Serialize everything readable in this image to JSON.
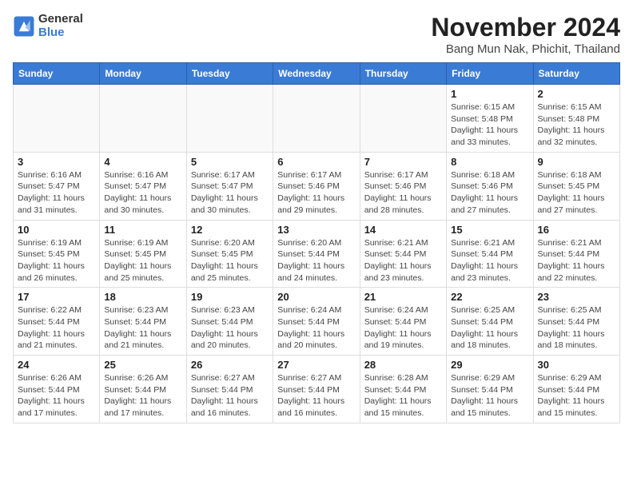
{
  "logo": {
    "general": "General",
    "blue": "Blue"
  },
  "title": "November 2024",
  "location": "Bang Mun Nak, Phichit, Thailand",
  "days_of_week": [
    "Sunday",
    "Monday",
    "Tuesday",
    "Wednesday",
    "Thursday",
    "Friday",
    "Saturday"
  ],
  "weeks": [
    [
      {
        "day": "",
        "info": ""
      },
      {
        "day": "",
        "info": ""
      },
      {
        "day": "",
        "info": ""
      },
      {
        "day": "",
        "info": ""
      },
      {
        "day": "",
        "info": ""
      },
      {
        "day": "1",
        "info": "Sunrise: 6:15 AM\nSunset: 5:48 PM\nDaylight: 11 hours and 33 minutes."
      },
      {
        "day": "2",
        "info": "Sunrise: 6:15 AM\nSunset: 5:48 PM\nDaylight: 11 hours and 32 minutes."
      }
    ],
    [
      {
        "day": "3",
        "info": "Sunrise: 6:16 AM\nSunset: 5:47 PM\nDaylight: 11 hours and 31 minutes."
      },
      {
        "day": "4",
        "info": "Sunrise: 6:16 AM\nSunset: 5:47 PM\nDaylight: 11 hours and 30 minutes."
      },
      {
        "day": "5",
        "info": "Sunrise: 6:17 AM\nSunset: 5:47 PM\nDaylight: 11 hours and 30 minutes."
      },
      {
        "day": "6",
        "info": "Sunrise: 6:17 AM\nSunset: 5:46 PM\nDaylight: 11 hours and 29 minutes."
      },
      {
        "day": "7",
        "info": "Sunrise: 6:17 AM\nSunset: 5:46 PM\nDaylight: 11 hours and 28 minutes."
      },
      {
        "day": "8",
        "info": "Sunrise: 6:18 AM\nSunset: 5:46 PM\nDaylight: 11 hours and 27 minutes."
      },
      {
        "day": "9",
        "info": "Sunrise: 6:18 AM\nSunset: 5:45 PM\nDaylight: 11 hours and 27 minutes."
      }
    ],
    [
      {
        "day": "10",
        "info": "Sunrise: 6:19 AM\nSunset: 5:45 PM\nDaylight: 11 hours and 26 minutes."
      },
      {
        "day": "11",
        "info": "Sunrise: 6:19 AM\nSunset: 5:45 PM\nDaylight: 11 hours and 25 minutes."
      },
      {
        "day": "12",
        "info": "Sunrise: 6:20 AM\nSunset: 5:45 PM\nDaylight: 11 hours and 25 minutes."
      },
      {
        "day": "13",
        "info": "Sunrise: 6:20 AM\nSunset: 5:44 PM\nDaylight: 11 hours and 24 minutes."
      },
      {
        "day": "14",
        "info": "Sunrise: 6:21 AM\nSunset: 5:44 PM\nDaylight: 11 hours and 23 minutes."
      },
      {
        "day": "15",
        "info": "Sunrise: 6:21 AM\nSunset: 5:44 PM\nDaylight: 11 hours and 23 minutes."
      },
      {
        "day": "16",
        "info": "Sunrise: 6:21 AM\nSunset: 5:44 PM\nDaylight: 11 hours and 22 minutes."
      }
    ],
    [
      {
        "day": "17",
        "info": "Sunrise: 6:22 AM\nSunset: 5:44 PM\nDaylight: 11 hours and 21 minutes."
      },
      {
        "day": "18",
        "info": "Sunrise: 6:23 AM\nSunset: 5:44 PM\nDaylight: 11 hours and 21 minutes."
      },
      {
        "day": "19",
        "info": "Sunrise: 6:23 AM\nSunset: 5:44 PM\nDaylight: 11 hours and 20 minutes."
      },
      {
        "day": "20",
        "info": "Sunrise: 6:24 AM\nSunset: 5:44 PM\nDaylight: 11 hours and 20 minutes."
      },
      {
        "day": "21",
        "info": "Sunrise: 6:24 AM\nSunset: 5:44 PM\nDaylight: 11 hours and 19 minutes."
      },
      {
        "day": "22",
        "info": "Sunrise: 6:25 AM\nSunset: 5:44 PM\nDaylight: 11 hours and 18 minutes."
      },
      {
        "day": "23",
        "info": "Sunrise: 6:25 AM\nSunset: 5:44 PM\nDaylight: 11 hours and 18 minutes."
      }
    ],
    [
      {
        "day": "24",
        "info": "Sunrise: 6:26 AM\nSunset: 5:44 PM\nDaylight: 11 hours and 17 minutes."
      },
      {
        "day": "25",
        "info": "Sunrise: 6:26 AM\nSunset: 5:44 PM\nDaylight: 11 hours and 17 minutes."
      },
      {
        "day": "26",
        "info": "Sunrise: 6:27 AM\nSunset: 5:44 PM\nDaylight: 11 hours and 16 minutes."
      },
      {
        "day": "27",
        "info": "Sunrise: 6:27 AM\nSunset: 5:44 PM\nDaylight: 11 hours and 16 minutes."
      },
      {
        "day": "28",
        "info": "Sunrise: 6:28 AM\nSunset: 5:44 PM\nDaylight: 11 hours and 15 minutes."
      },
      {
        "day": "29",
        "info": "Sunrise: 6:29 AM\nSunset: 5:44 PM\nDaylight: 11 hours and 15 minutes."
      },
      {
        "day": "30",
        "info": "Sunrise: 6:29 AM\nSunset: 5:44 PM\nDaylight: 11 hours and 15 minutes."
      }
    ]
  ]
}
